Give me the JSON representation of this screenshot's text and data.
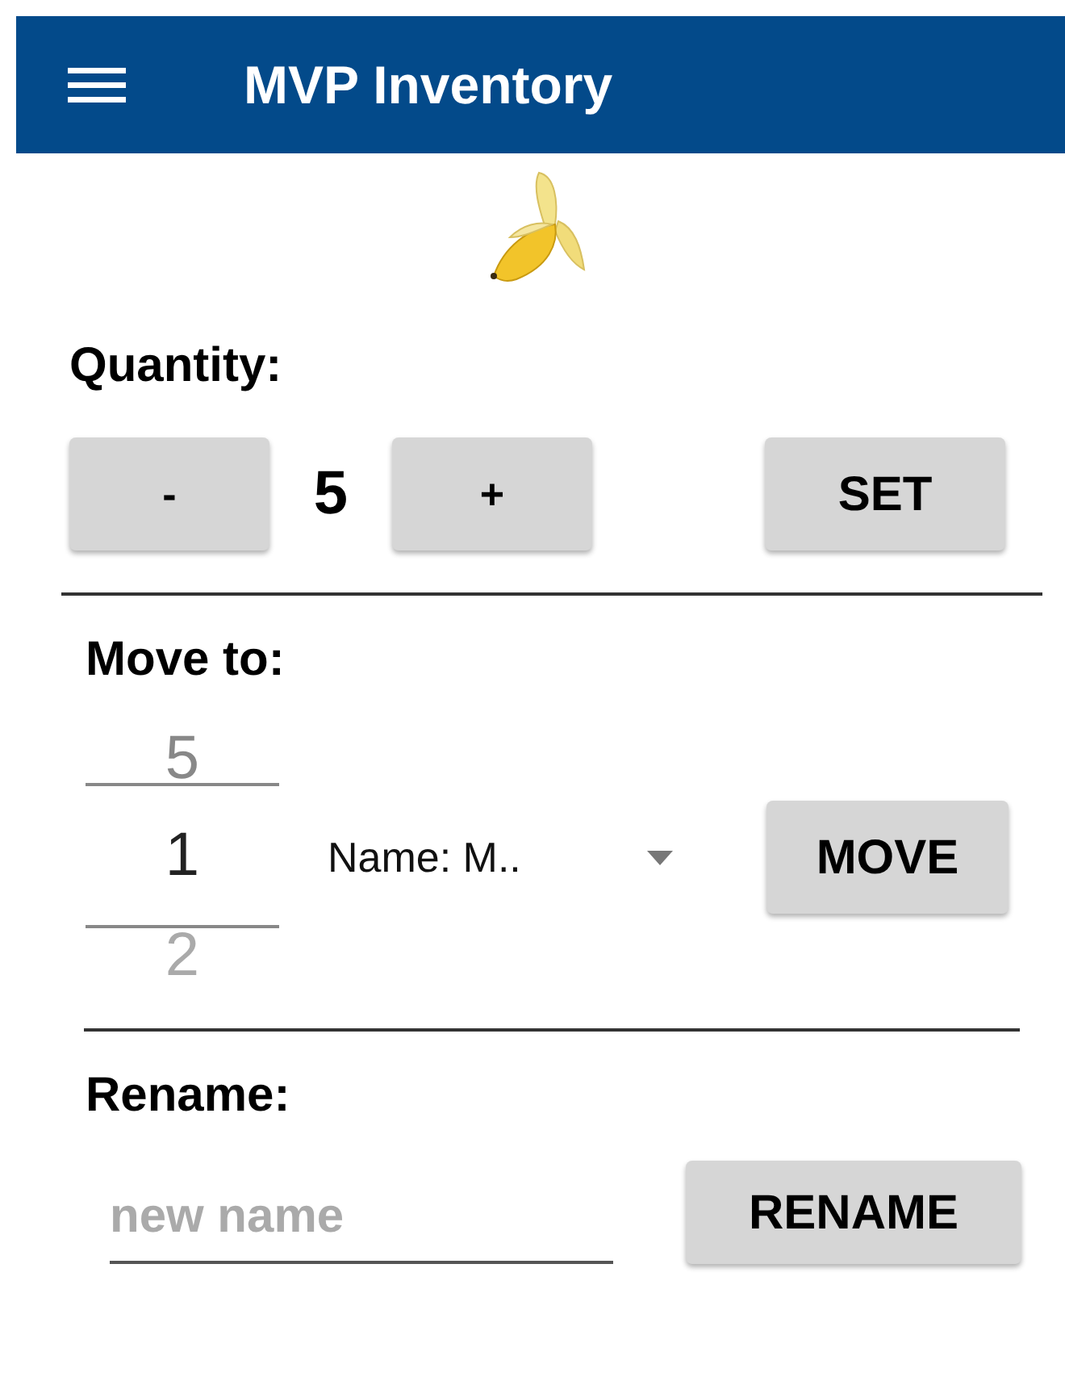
{
  "app_bar": {
    "title": "MVP Inventory"
  },
  "quantity": {
    "label": "Quantity:",
    "decrement": "-",
    "value": "5",
    "increment": "+",
    "set_button": "SET"
  },
  "move": {
    "label": "Move to:",
    "picker": {
      "previous": "5",
      "current": "1",
      "next": "2"
    },
    "dropdown": {
      "value": "Name: M.."
    },
    "move_button": "MOVE"
  },
  "rename": {
    "label": "Rename:",
    "field": {
      "placeholder": "new name"
    },
    "rename_button": "RENAME"
  }
}
